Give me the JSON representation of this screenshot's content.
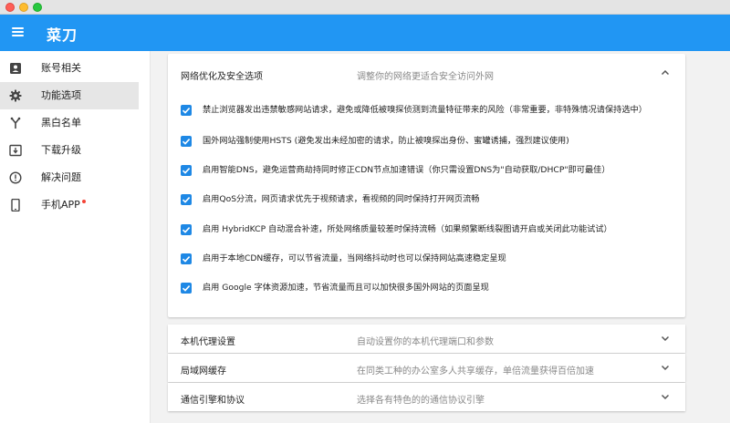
{
  "app": {
    "title": "菜刀"
  },
  "sidebar": {
    "items": [
      {
        "label": "账号相关",
        "icon": "account-box-icon"
      },
      {
        "label": "功能选项",
        "icon": "gear-icon",
        "active": true
      },
      {
        "label": "黑白名单",
        "icon": "fork-icon"
      },
      {
        "label": "下载升级",
        "icon": "download-box-icon"
      },
      {
        "label": "解决问题",
        "icon": "alert-circle-icon"
      },
      {
        "label": "手机APP",
        "icon": "phone-icon",
        "badge": true
      }
    ]
  },
  "main": {
    "expanded": {
      "title": "网络优化及安全选项",
      "description": "调整你的网络更适合安全访问外网",
      "options": [
        {
          "label": "禁止浏览器发出违禁敏感网站请求，避免或降低被嗅探侦测到流量特征带来的风险（非常重要，非特殊情况请保持选中）",
          "checked": true
        },
        {
          "label": "国外网站强制使用HSTS (避免发出未经加密的请求，防止被嗅探出身份、蜜罐诱捕，强烈建议使用)",
          "checked": true
        },
        {
          "label": "启用智能DNS，避免运营商劫持同时修正CDN节点加速错误（你只需设置DNS为\"自动获取/DHCP\"即可最佳）",
          "checked": true
        },
        {
          "label": "启用QoS分流，网页请求优先于视频请求，看视频的同时保持打开网页流畅",
          "checked": true
        },
        {
          "label": "启用 HybridKCP 自动混合补速，所处网络质量较差时保持流畅（如果频繁断线裂图请开启或关闭此功能试试）",
          "checked": true
        },
        {
          "label": "启用于本地CDN缓存，可以节省流量，当网络抖动时也可以保持网站高速稳定呈现",
          "checked": true
        },
        {
          "label": "启用 Google 字体资源加速，节省流量而且可以加快很多国外网站的页面呈现",
          "checked": true
        }
      ]
    },
    "sections": [
      {
        "title": "本机代理设置",
        "description": "自动设置你的本机代理端口和参数"
      },
      {
        "title": "局域网缓存",
        "description": "在同类工种的办公室多人共享缓存，单倍流量获得百倍加速"
      },
      {
        "title": "通信引擎和协议",
        "description": "选择各有特色的的通信协议引擎"
      }
    ]
  },
  "colors": {
    "accent": "#2196f3",
    "checkbox": "#1e88e5",
    "badge": "#f44336"
  }
}
